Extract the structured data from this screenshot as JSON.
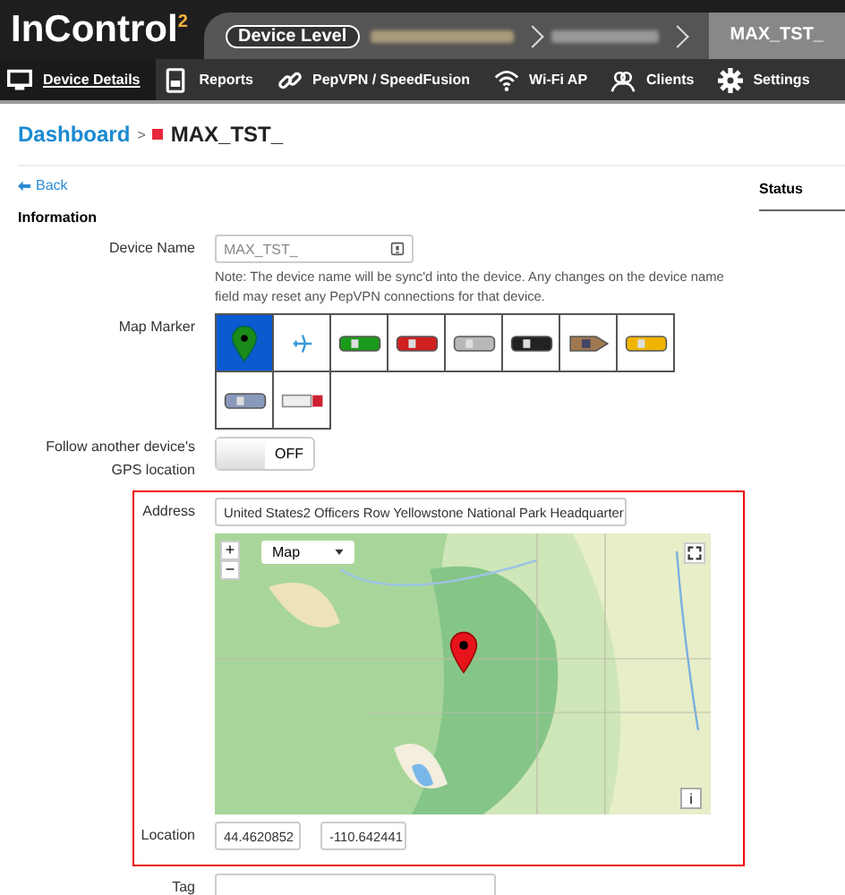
{
  "header": {
    "logo": "InControl$^{2}$",
    "level_badge": "Device Level",
    "current_crumb": "MAX_TST_"
  },
  "nav": [
    {
      "label": "Device Details",
      "kind": "monitor",
      "selected": true
    },
    {
      "label": "Reports",
      "kind": "report",
      "selected": false
    },
    {
      "label": "PepVPN / SpeedFusion",
      "kind": "link",
      "selected": false
    },
    {
      "label": "Wi-Fi AP",
      "kind": "wifi",
      "selected": false
    },
    {
      "label": "Clients",
      "kind": "users",
      "selected": false
    },
    {
      "label": "Settings",
      "kind": "gear",
      "selected": false
    }
  ],
  "breadcrumb": {
    "link": "Dashboard",
    "separator": ">",
    "device": "MAX_TST_"
  },
  "back": "Back",
  "side_tab": "Status",
  "section": "Information",
  "device_name": {
    "label": "Device Name",
    "value": "MAX_TST_",
    "note": "Note: The device name will be sync'd into the device. Any changes on the device name field may reset any PepVPN connections for that device."
  },
  "map_marker": {
    "label": "Map Marker",
    "markers": [
      {
        "kind": "pin",
        "selected": true
      },
      {
        "kind": "plane",
        "selected": false
      },
      {
        "kind": "bus",
        "selected": false
      },
      {
        "kind": "firetruck",
        "selected": false
      },
      {
        "kind": "car",
        "selected": false
      },
      {
        "kind": "police",
        "selected": false
      },
      {
        "kind": "boat",
        "selected": false
      },
      {
        "kind": "taxi",
        "selected": false
      },
      {
        "kind": "train",
        "selected": false
      },
      {
        "kind": "truck",
        "selected": false
      }
    ]
  },
  "follow_gps": {
    "label": "Follow another device's GPS location",
    "on": false,
    "text": "OFF"
  },
  "address": {
    "label": "Address",
    "value": "United States2 Officers Row Yellowstone National Park Headquarter"
  },
  "map": {
    "zoom_in": "+",
    "zoom_out": "−",
    "type": "Map",
    "info": "i"
  },
  "location": {
    "label": "Location",
    "latitude": "44.4620852",
    "longitude": "-110.642441"
  },
  "tag": {
    "label": "Tag"
  }
}
